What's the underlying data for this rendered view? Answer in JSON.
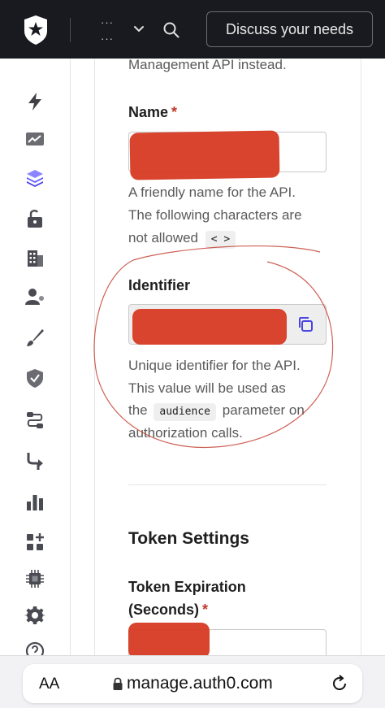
{
  "topbar": {
    "tenant_dots_top": "···",
    "tenant_dots_bottom": "···",
    "discuss_label": "Discuss your needs"
  },
  "sidebar": {
    "icons": [
      "bolt-icon",
      "activity-icon",
      "applications-icon",
      "authentication-icon",
      "organizations-icon",
      "user-management-icon",
      "branding-icon",
      "security-icon",
      "pipeline-icon",
      "actions-icon",
      "monitoring-icon",
      "marketplace-icon",
      "extensions-icon",
      "settings-icon",
      "help-icon"
    ]
  },
  "form": {
    "intro_tail": "Management API instead.",
    "name_label": "Name",
    "required_mark": "*",
    "name_help_1": "A friendly name for the API.",
    "name_help_2": "The following characters are",
    "name_help_3": "not allowed",
    "name_disallowed": "< >",
    "identifier_label": "Identifier",
    "identifier_help_1": "Unique identifier for the API.",
    "identifier_help_2": "This value will be used as",
    "identifier_help_3a": "the",
    "identifier_code": "audience",
    "identifier_help_3b": "parameter on",
    "identifier_help_4": "authorization calls.",
    "section_title": "Token Settings",
    "token_label_1": "Token Expiration",
    "token_label_2": "(Seconds)"
  },
  "browser": {
    "aa_label": "AA",
    "url": "manage.auth0.com"
  },
  "colors": {
    "topbar_bg": "#181a1f",
    "accent_active": "#635dff",
    "required": "#c0392b",
    "redaction": "#d63a22"
  }
}
